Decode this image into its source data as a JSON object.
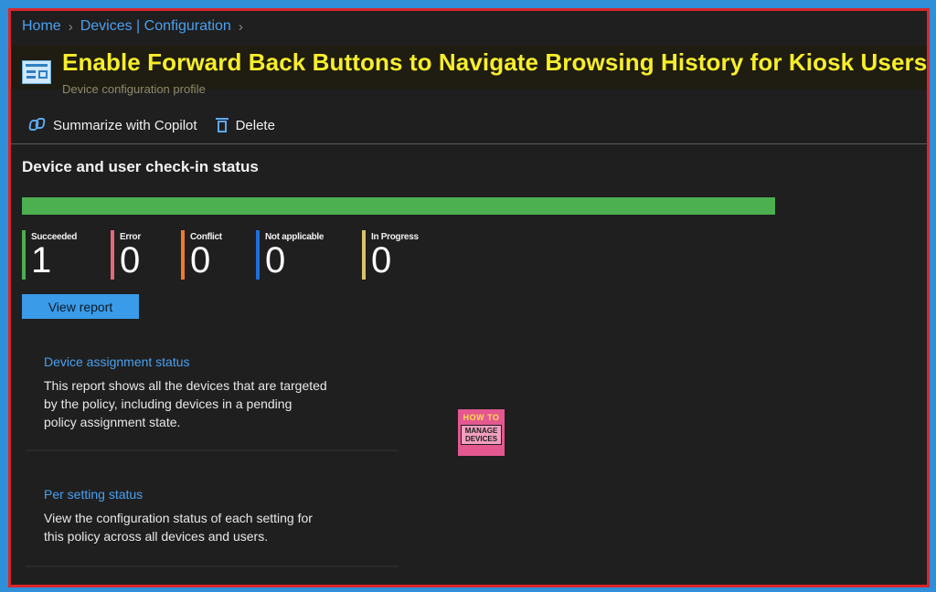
{
  "breadcrumb": {
    "items": [
      "Home",
      "Devices | Configuration"
    ],
    "separator": ">"
  },
  "header": {
    "title": "Enable Forward Back Buttons to Navigate Browsing History for Kiosk Users",
    "subtitle": "Device configuration profile",
    "title_color": "#f7ee2a"
  },
  "toolbar": {
    "copilot_label": "Summarize with Copilot",
    "delete_label": "Delete"
  },
  "status": {
    "section_title": "Device and user check-in status",
    "progress_fraction": 1.0,
    "stats": [
      {
        "label": "Succeeded",
        "value": "1",
        "color": "#4caf50"
      },
      {
        "label": "Error",
        "value": "0",
        "color": "#e06a7a"
      },
      {
        "label": "Conflict",
        "value": "0",
        "color": "#f07a2a"
      },
      {
        "label": "Not applicable",
        "value": "0",
        "color": "#1e6fd8"
      },
      {
        "label": "In Progress",
        "value": "0",
        "color": "#d9c36a"
      }
    ],
    "view_report_label": "View report"
  },
  "cards": [
    {
      "title": "Device assignment status",
      "description": "This report shows all the devices that are targeted by the policy, including devices in a pending policy assignment state."
    },
    {
      "title": "Per setting status",
      "description": "View the configuration status of each setting for this policy across all devices and users."
    }
  ],
  "watermark": {
    "line1": "HOW TO",
    "line2": "MANAGE DEVICES"
  }
}
